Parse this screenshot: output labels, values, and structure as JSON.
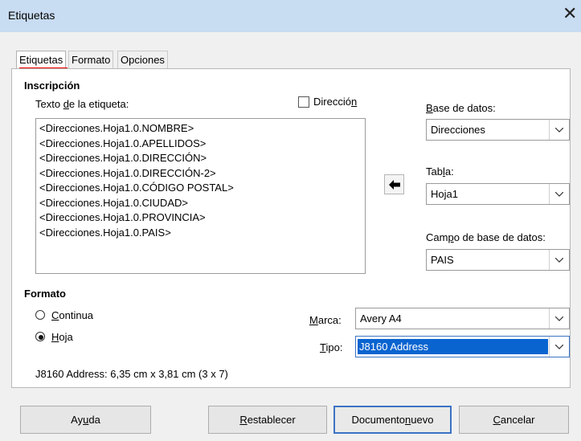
{
  "window": {
    "title": "Etiquetas",
    "close_glyph": "✕"
  },
  "tabs": [
    {
      "label": "Etiquetas",
      "active": true
    },
    {
      "label": "Formato",
      "active": false
    },
    {
      "label": "Opciones",
      "active": false
    }
  ],
  "inscripcion": {
    "heading": "Inscripción",
    "text_label_pre": "Texto ",
    "text_label_u": "d",
    "text_label_post": "e la etiqueta:",
    "direccion_pre": "Direcció",
    "direccion_u": "n",
    "direccion_checked": false,
    "lines": [
      "<Direcciones.Hoja1.0.NOMBRE>",
      "<Direcciones.Hoja1.0.APELLIDOS>",
      "<Direcciones.Hoja1.0.DIRECCIÓN>",
      "<Direcciones.Hoja1.0.DIRECCIÓN-2>",
      "<Direcciones.Hoja1.0.CÓDIGO POSTAL>",
      "<Direcciones.Hoja1.0.CIUDAD>",
      "<Direcciones.Hoja1.0.PROVINCIA>",
      "<Direcciones.Hoja1.0.PAIS>"
    ],
    "database": {
      "label_u": "B",
      "label_post": "ase de datos:",
      "value": "Direcciones"
    },
    "table": {
      "label_pre": "Tab",
      "label_u": "l",
      "label_post": "a:",
      "value": "Hoja1"
    },
    "field": {
      "label_pre": "Cam",
      "label_u": "p",
      "label_post": "o de base de datos:",
      "value": "PAIS"
    }
  },
  "formato": {
    "heading": "Formato",
    "continua_u": "C",
    "continua_post": "ontinua",
    "hoja_u": "H",
    "hoja_post": "oja",
    "selected": "hoja",
    "marca": {
      "label_pre": "",
      "label_u": "M",
      "label_post": "arca:",
      "value": "Avery A4"
    },
    "tipo": {
      "label_u": "T",
      "label_post": "ipo:",
      "value": "J8160 Address"
    },
    "info": "J8160 Address: 6,35 cm x 3,81 cm (3 x 7)"
  },
  "buttons": {
    "help_pre": "Ay",
    "help_u": "u",
    "help_post": "da",
    "reset_u": "R",
    "reset_post": "establecer",
    "new_pre": "Documento ",
    "new_u": "n",
    "new_post": "uevo",
    "cancel_u": "C",
    "cancel_post": "ancelar"
  }
}
